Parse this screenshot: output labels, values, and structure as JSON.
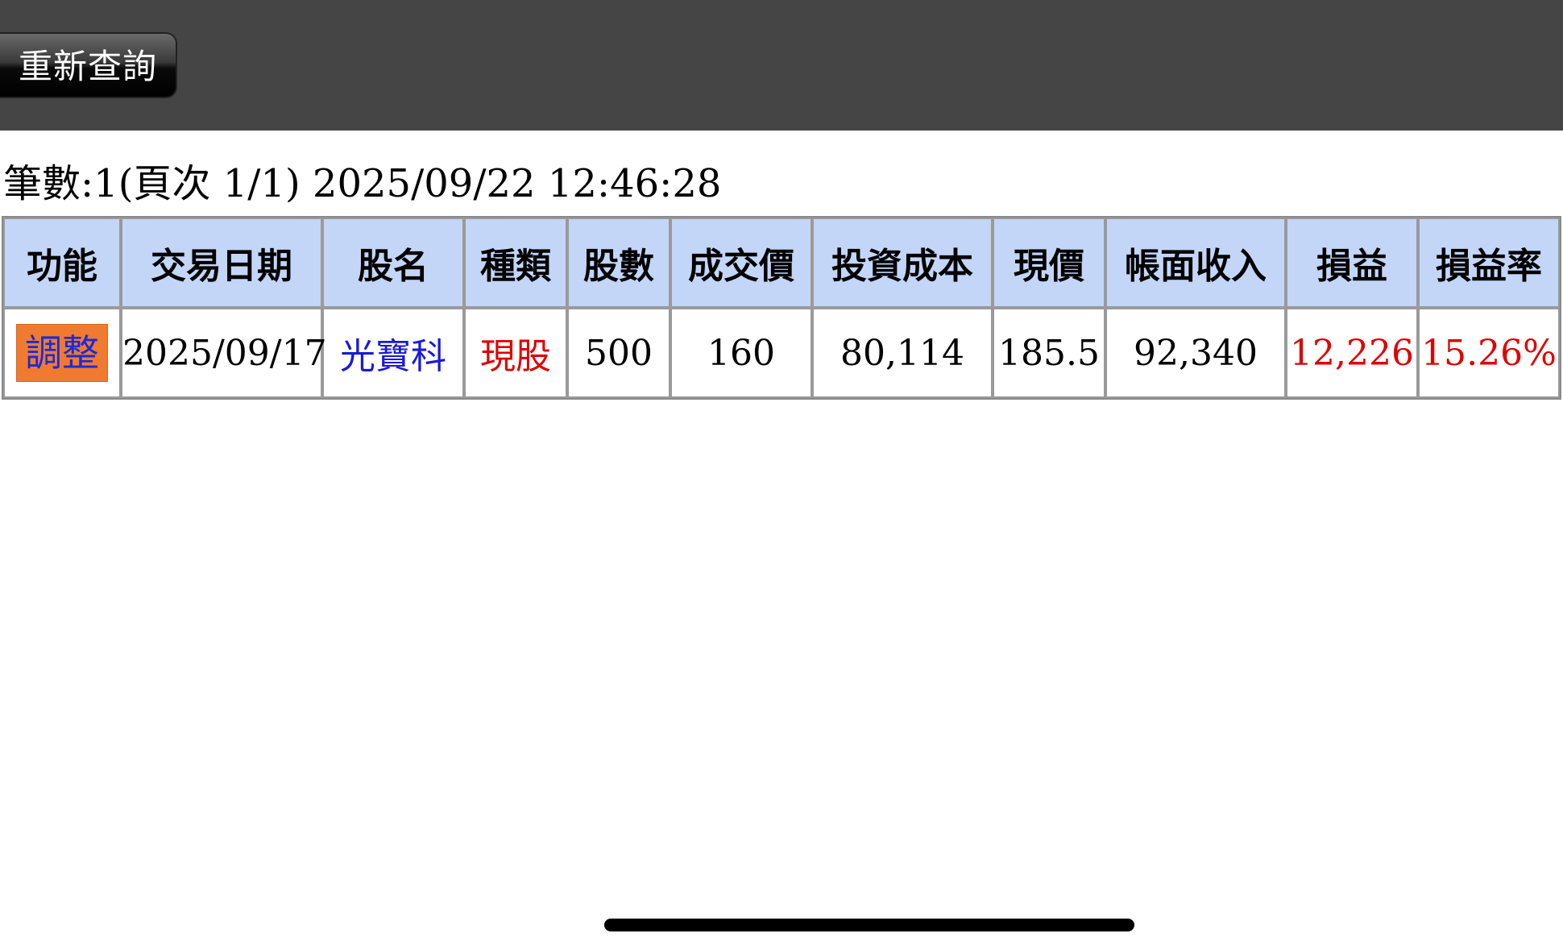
{
  "toolbar": {
    "requery_label": "重新查詢"
  },
  "summary": {
    "text": "筆數:1(頁次 1/1) 2025/09/22 12:46:28"
  },
  "table": {
    "headers": [
      "功能",
      "交易日期",
      "股名",
      "種類",
      "股數",
      "成交價",
      "投資成本",
      "現價",
      "帳面收入",
      "損益",
      "損益率"
    ],
    "rows": [
      {
        "action": "調整",
        "date": "2025/09/17",
        "name": "光寶科",
        "type": "現股",
        "shares": "500",
        "price": "160",
        "cost": "80,114",
        "current_price": "185.5",
        "book_income": "92,340",
        "profit": "12,226",
        "profit_rate": "15.26%"
      }
    ]
  },
  "colors": {
    "topbar": "#454545",
    "header_bg": "#c3d6f7",
    "adjust_bg": "#f07a30",
    "link_blue": "#1a1ad8",
    "profit_red": "#e00000"
  }
}
